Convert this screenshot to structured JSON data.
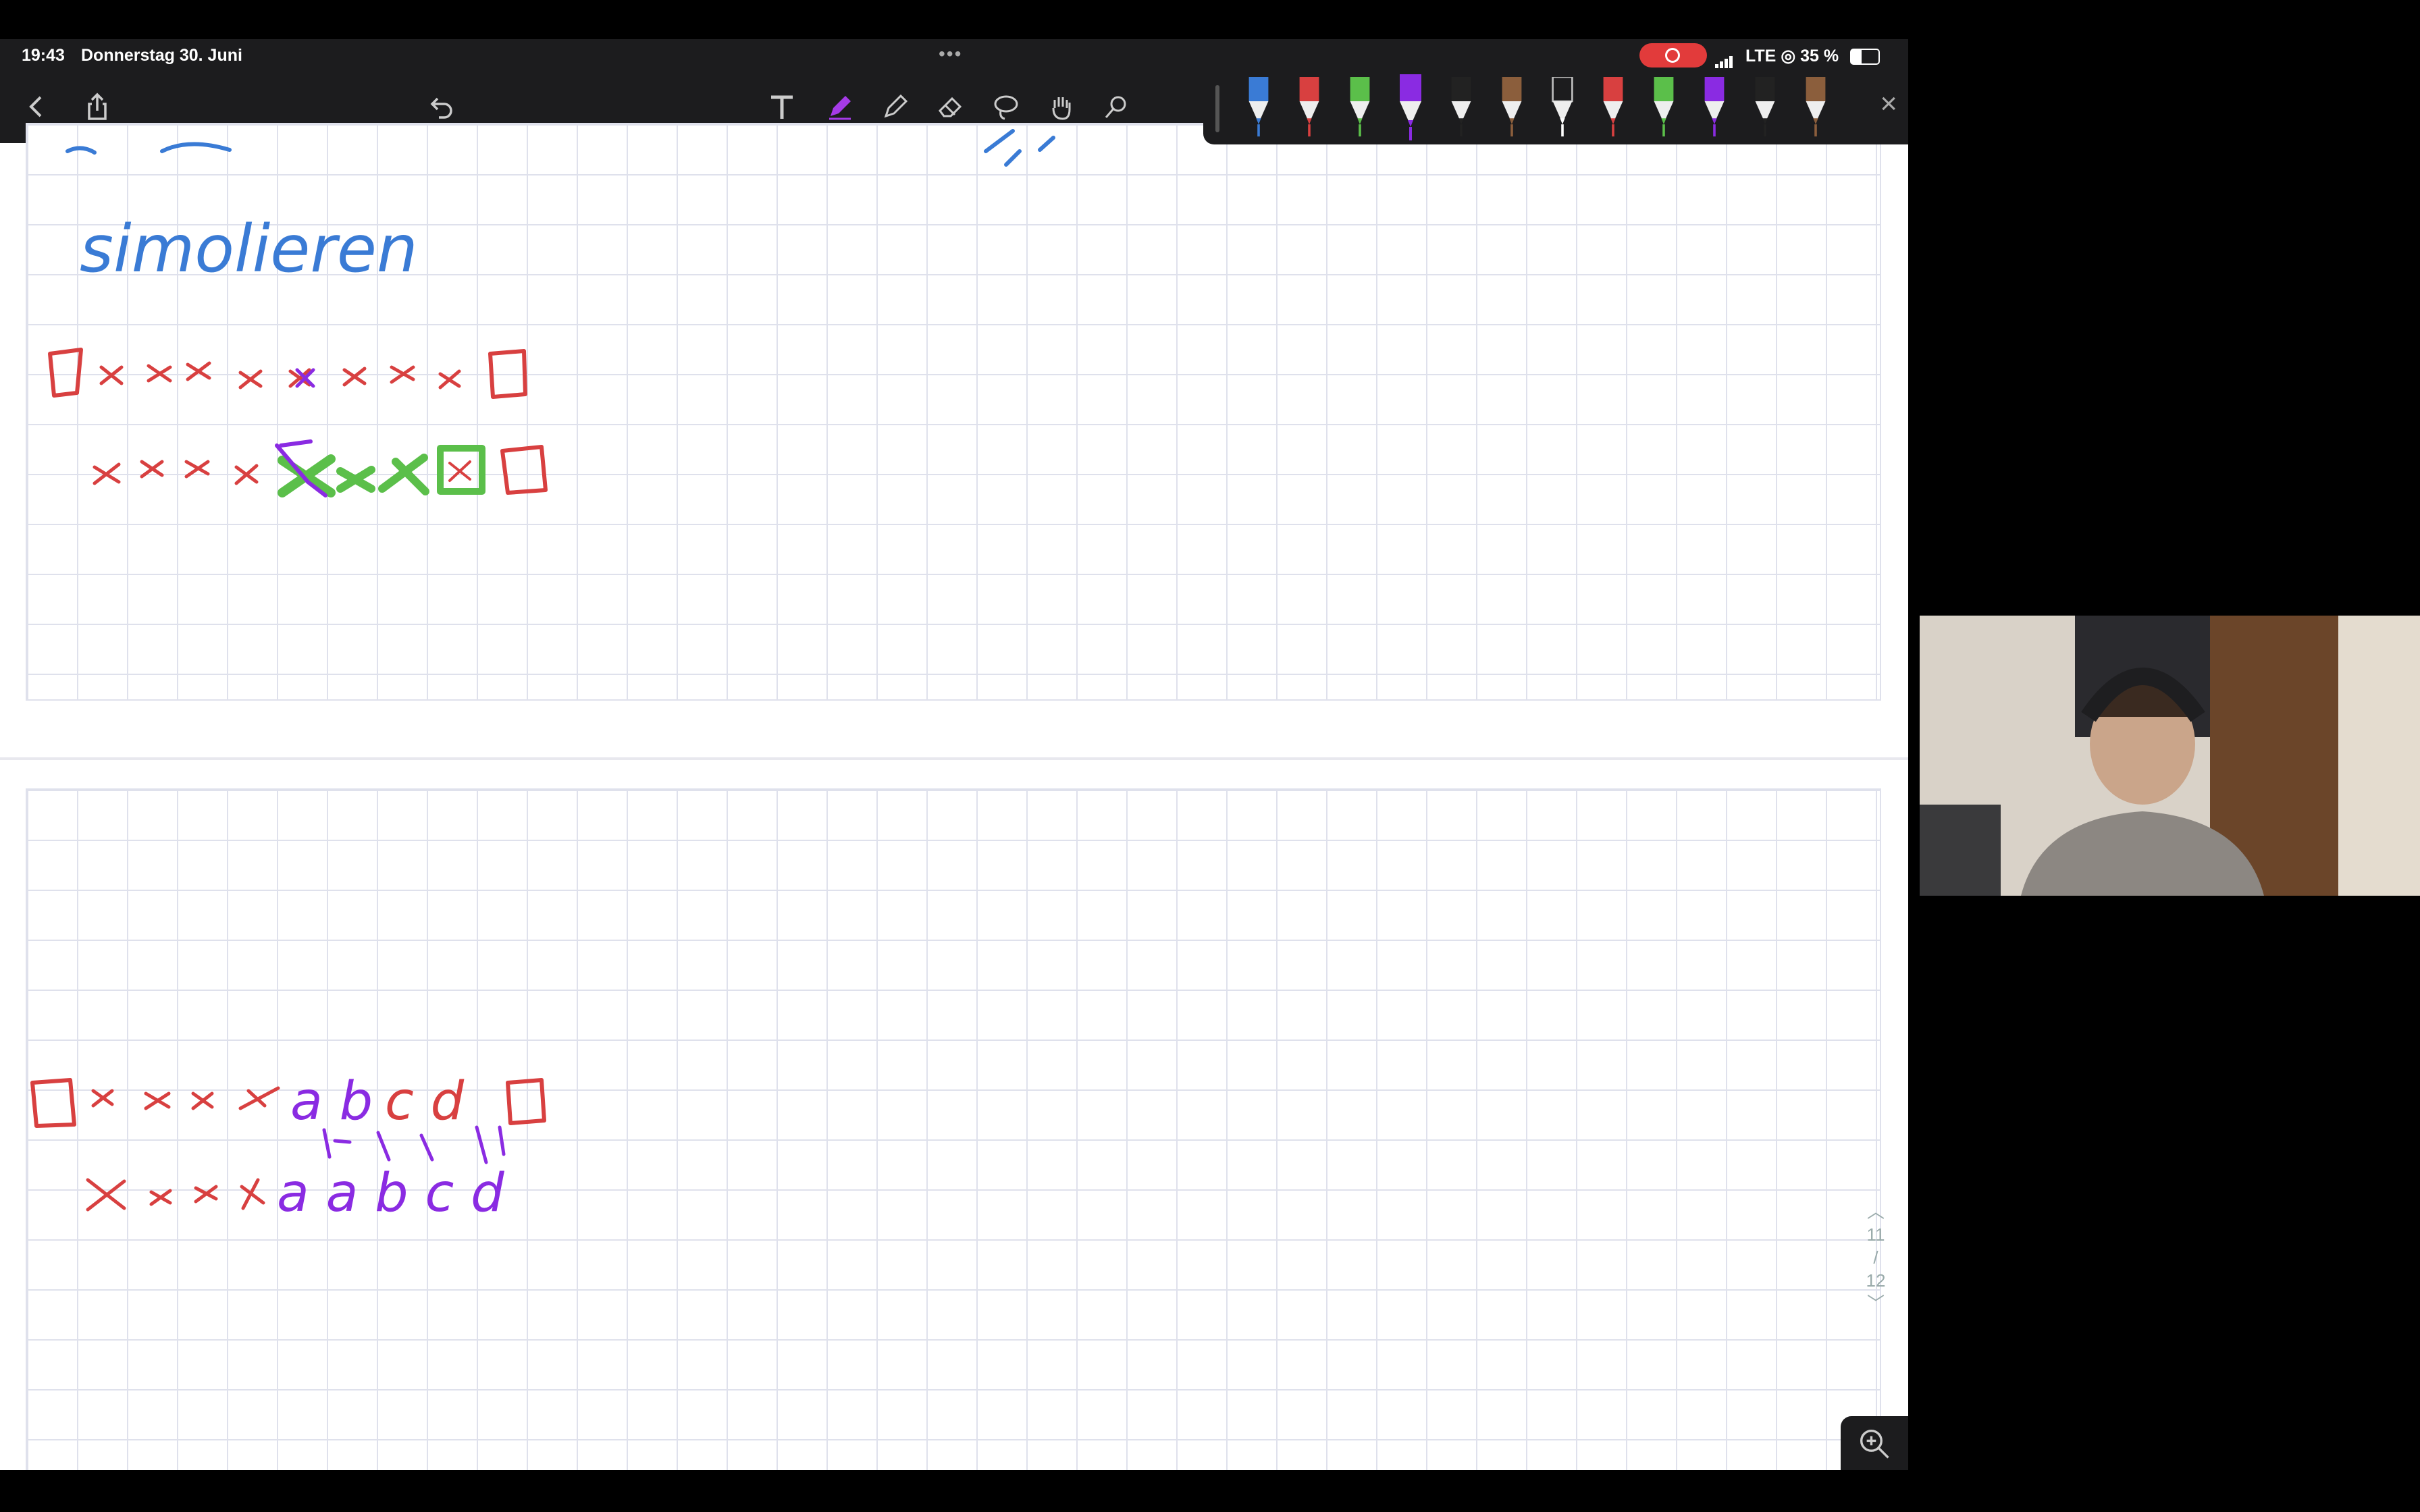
{
  "status_bar": {
    "time": "19:43",
    "date": "Donnerstag 30. Juni",
    "network": "LTE",
    "battery": "35 %",
    "multitasking": "•••"
  },
  "toolbar": {
    "icons": [
      "back-icon",
      "share-icon",
      "undo-icon",
      "text-tool-icon",
      "pen-tool-icon",
      "pencil-tool-icon",
      "eraser-tool-icon",
      "lasso-tool-icon",
      "hand-tool-icon",
      "shapes-tool-icon",
      "microphone-icon",
      "add-icon",
      "more-icon",
      "pages-icon"
    ]
  },
  "pen_palette": {
    "colors": [
      "#3a7bd5",
      "#d84040",
      "#5bbf4a",
      "#8a2be2",
      "#222222",
      "#8b5e3c",
      "#ffffff",
      "#d84040",
      "#5bbf4a",
      "#8a2be2",
      "#222222",
      "#8b5e3c"
    ],
    "close": "×"
  },
  "page1": {
    "word": "simolieren",
    "row1": "□ x x x x x x x x □",
    "row2": "x x x x x x x □ □"
  },
  "page2": {
    "row1": "□ x x x x a b c d □",
    "row2": "x x x x a a b c d"
  },
  "page_counter": {
    "current": "11",
    "slash": "/",
    "total": "12"
  },
  "accent": {
    "red": "#d84040",
    "blue": "#3a7bd5",
    "green": "#5bbf4a",
    "purple": "#8a2be2"
  }
}
